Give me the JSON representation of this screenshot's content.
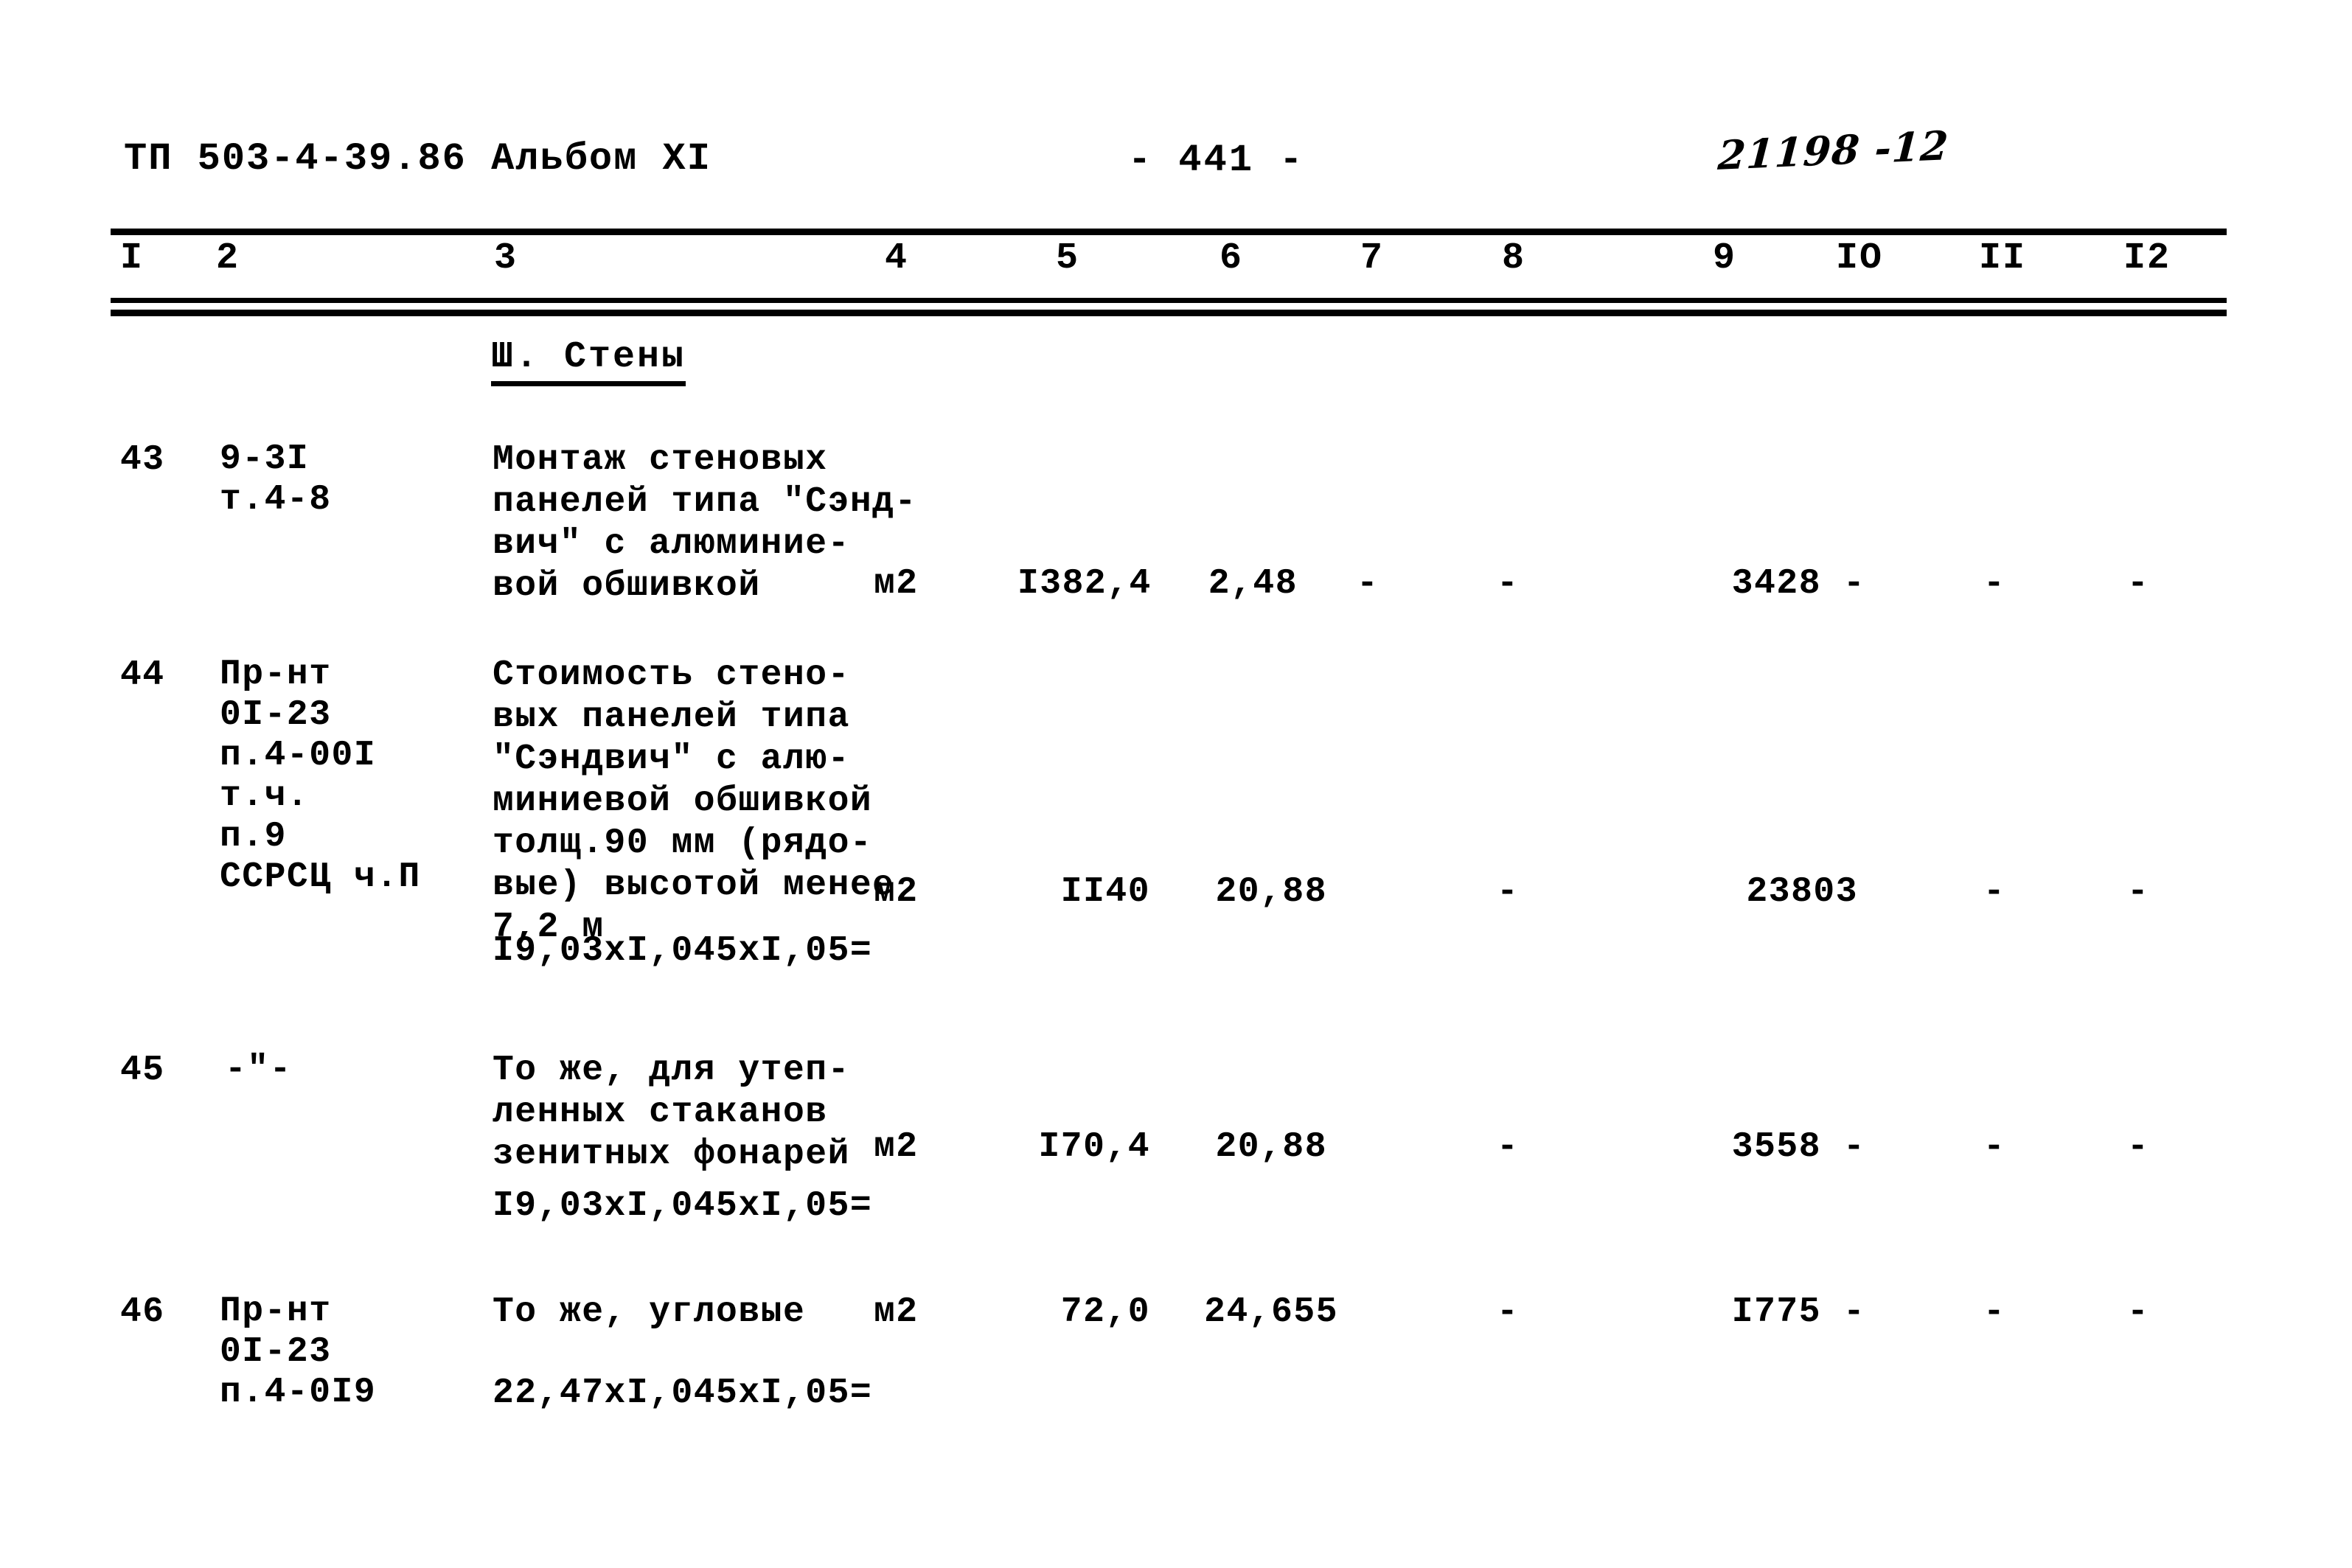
{
  "header": {
    "doc_code": "ТП 503-4-39.86 Альбом XI",
    "page_number": "- 441 -",
    "hand_note": "21198 -12"
  },
  "column_numbers": [
    "I",
    "2",
    "3",
    "4",
    "5",
    "6",
    "7",
    "8",
    "9",
    "IO",
    "II",
    "I2"
  ],
  "section": {
    "heading": "Ш. Стены"
  },
  "rows": [
    {
      "no": "43",
      "refs": "9-3I\nт.4-8",
      "description": "Монтаж стеновых\nпанелей типа \"Сэнд-\nвич\" с алюминие-\nвой обшивкой",
      "unit": "м2",
      "c5": "I382,4",
      "c6": "2,48",
      "c7": "-",
      "c8": "-",
      "c9": "3428",
      "c10": "-",
      "c11": "-",
      "c12": "-",
      "formula": ""
    },
    {
      "no": "44",
      "refs": "Пр-нт\n0I-23\nп.4-00I\nт.ч.\nп.9\nССРСЦ ч.П",
      "description": "Стоимость стено-\nвых панелей типа\n\"Сэндвич\" с алю-\nминиевой обшивкой\nтолщ.90 мм (рядо-\nвые) высотой менее\n7,2 м",
      "unit": "м2",
      "c5": "II40",
      "c6": "20,88",
      "c7": "",
      "c8": "-",
      "c9": "23803",
      "c10": "",
      "c11": "-",
      "c12": "-",
      "formula": "I9,03xI,045xI,05="
    },
    {
      "no": "45",
      "refs": "-\"-",
      "description": "То же, для утеп-\nленных стаканов\nзенитных фонарей",
      "unit": "м2",
      "c5": "I70,4",
      "c6": "20,88",
      "c7": "",
      "c8": "-",
      "c9": "3558",
      "c10": "-",
      "c11": "-",
      "c12": "-",
      "formula": "I9,03xI,045xI,05="
    },
    {
      "no": "46",
      "refs": "Пр-нт\n0I-23\nп.4-0I9",
      "description": "То же, угловые",
      "unit": "м2",
      "c5": "72,0",
      "c6": "24,655",
      "c7": "",
      "c8": "-",
      "c9": "I775",
      "c10": "-",
      "c11": "-",
      "c12": "-",
      "formula": "22,47xI,045xI,05="
    }
  ]
}
